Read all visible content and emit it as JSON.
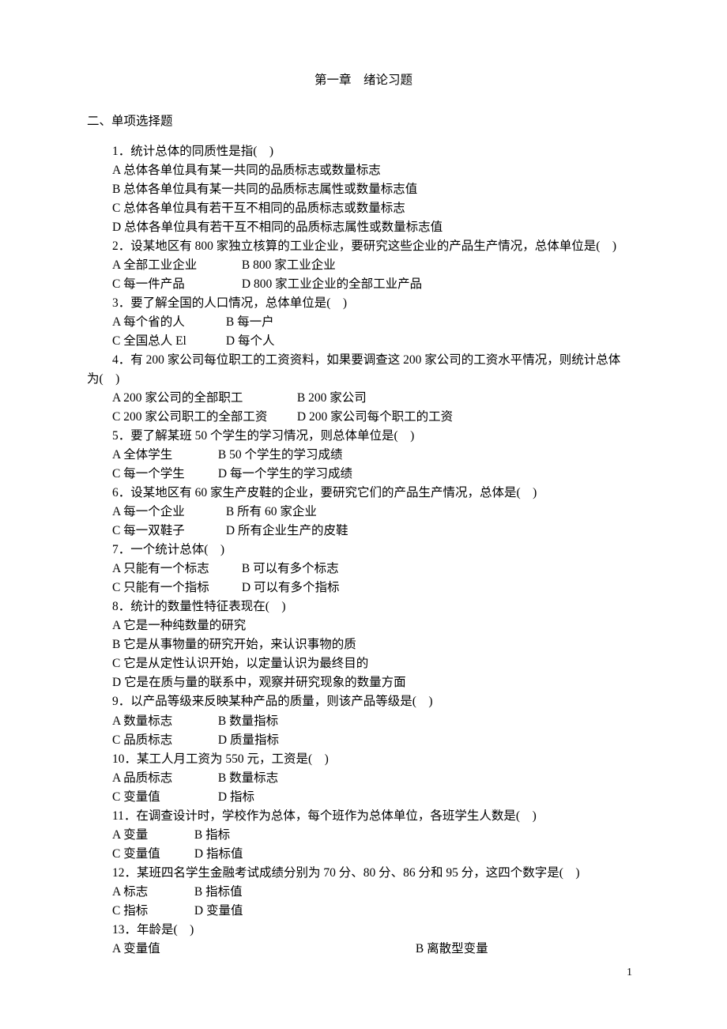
{
  "title": "第一章　绪论习题",
  "section_heading": "二、单项选择题",
  "page_number": "1",
  "questions": [
    {
      "stem": "1．统计总体的同质性是指(　)",
      "options_block": [
        "A 总体各单位具有某一共同的品质标志或数量标志",
        "B 总体各单位具有某一共同的品质标志属性或数量标志值",
        "C 总体各单位具有若干互不相同的品质标志或数量标志",
        "D 总体各单位具有若干互不相同的品质标志属性或数量标志值"
      ]
    },
    {
      "stem": "2．设某地区有 800 家独立核算的工业企业，要研究这些企业的产品生产情况，总体单位是(　)",
      "options_pairs": [
        [
          "A 全部工业企业",
          "B 800 家工业企业"
        ],
        [
          "C 每一件产品",
          "D 800 家工业企业的全部工业产品"
        ]
      ]
    },
    {
      "stem": "3．要了解全国的人口情况，总体单位是(　)",
      "options_pairs": [
        [
          "A 每个省的人",
          "B 每一户"
        ],
        [
          "C 全国总人 El",
          "D 每个人"
        ]
      ]
    },
    {
      "stem_wrapped": {
        "line1": "4．有 200 家公司每位职工的工资资料，如果要调查这 200 家公司的工资水平情况，则统计总体",
        "line2_noindent": "为(　)"
      },
      "options_pairs": [
        [
          "A 200 家公司的全部职工",
          "B 200 家公司"
        ],
        [
          "C 200 家公司职工的全部工资",
          "D 200 家公司每个职工的工资"
        ]
      ]
    },
    {
      "stem": "5．要了解某班 50 个学生的学习情况，则总体单位是(　)",
      "options_pairs": [
        [
          "A 全体学生",
          "B 50 个学生的学习成绩"
        ],
        [
          "C 每一个学生",
          "D 每一个学生的学习成绩"
        ]
      ]
    },
    {
      "stem": "6．设某地区有 60 家生产皮鞋的企业，要研究它们的产品生产情况，总体是(　)",
      "options_pairs": [
        [
          "A 每一个企业",
          "B 所有 60 家企业"
        ],
        [
          "C 每一双鞋子",
          "D 所有企业生产的皮鞋"
        ]
      ]
    },
    {
      "stem": "7．一个统计总体(　)",
      "options_pairs": [
        [
          "A 只能有一个标志",
          "B 可以有多个标志"
        ],
        [
          "C 只能有一个指标",
          "D 可以有多个指标"
        ]
      ]
    },
    {
      "stem": "8．统计的数量性特征表现在(　)",
      "options_block": [
        "A 它是一种纯数量的研究",
        "B 它是从事物量的研究开始，来认识事物的质",
        "C 它是从定性认识开始，以定量认识为最终目的",
        "D 它是在质与量的联系中，观察并研究现象的数量方面"
      ]
    },
    {
      "stem": "9．以产品等级来反映某种产品的质量，则该产品等级是(　)",
      "options_pairs": [
        [
          "A 数量标志",
          "B 数量指标"
        ],
        [
          "C 品质标志",
          "D 质量指标"
        ]
      ]
    },
    {
      "stem": "10．某工人月工资为 550 元，工资是(　)",
      "options_pairs": [
        [
          "A 品质标志",
          "B 数量标志"
        ],
        [
          "C 变量值",
          "D 指标"
        ]
      ]
    },
    {
      "stem": "11．在调查设计时，学校作为总体，每个班作为总体单位，各班学生人数是(　)",
      "options_pairs": [
        [
          "A 变量",
          "B 指标"
        ],
        [
          "C 变量值",
          "D 指标值"
        ]
      ]
    },
    {
      "stem": "12．某班四名学生金融考试成绩分别为 70 分、80 分、86 分和 95 分，这四个数字是(　)",
      "options_pairs": [
        [
          "A 标志",
          "B 指标值"
        ],
        [
          "C 指标",
          "D 变量值"
        ]
      ]
    },
    {
      "stem": "13．年龄是(　)",
      "options_wide": [
        [
          "A 变量值",
          "B 离散型变量"
        ]
      ]
    }
  ]
}
